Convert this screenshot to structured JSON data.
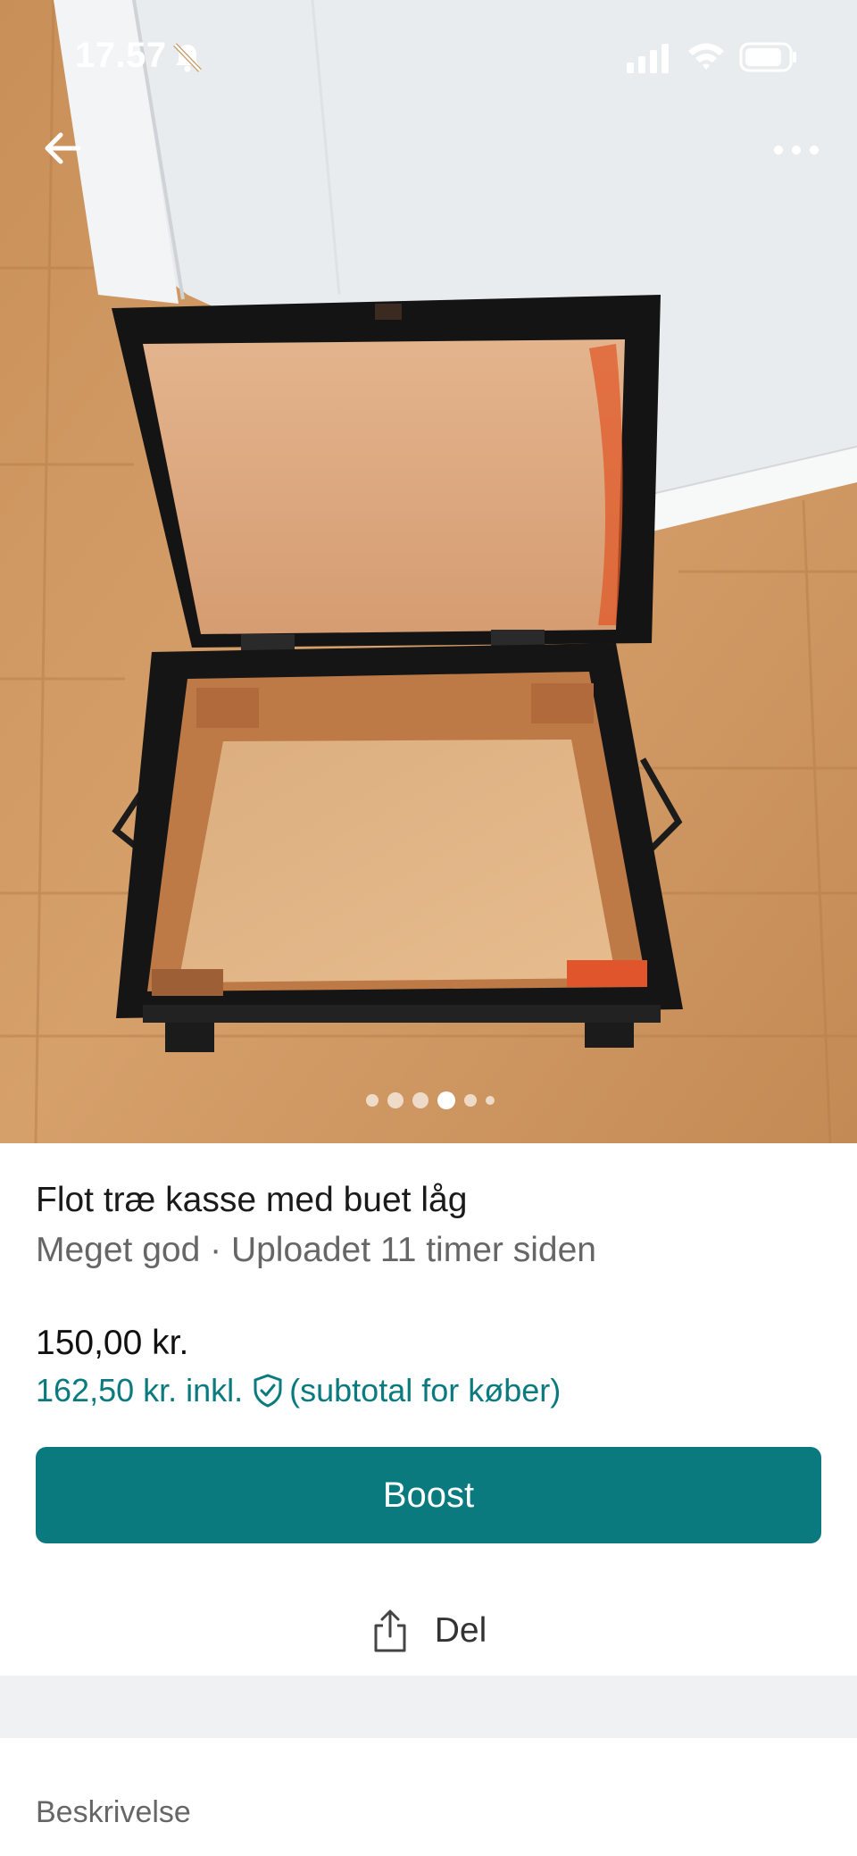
{
  "status_bar": {
    "time": "17.57",
    "icons": [
      "bell-muted-icon",
      "signal-icon",
      "wifi-icon",
      "battery-icon"
    ]
  },
  "navigation": {
    "back_icon": "arrow-left-icon",
    "more_icon": "more-horizontal-icon"
  },
  "gallery": {
    "image_count": 6,
    "active_index": 3
  },
  "listing": {
    "title": "Flot træ kasse med buet låg",
    "meta": "Meget god · Uploadet 11 timer siden",
    "price": "150,00 kr.",
    "price_incl": "162,50 kr. inkl.",
    "price_incl_note": "(subtotal for køber)"
  },
  "actions": {
    "boost_label": "Boost",
    "share_label": "Del"
  },
  "sections": {
    "description_label": "Beskrivelse"
  },
  "colors": {
    "accent": "#0a7a7f",
    "divider": "#eff1f2"
  }
}
